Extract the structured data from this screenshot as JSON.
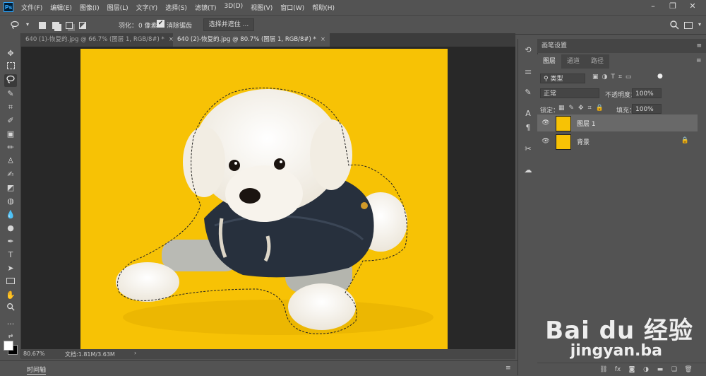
{
  "menubar": {
    "logo": "Ps",
    "items": [
      "文件(F)",
      "编辑(E)",
      "图像(I)",
      "图层(L)",
      "文字(Y)",
      "选择(S)",
      "滤镜(T)",
      "3D(D)",
      "视图(V)",
      "窗口(W)",
      "帮助(H)"
    ]
  },
  "options": {
    "feather_label": "羽化：",
    "feather_value": "0 像素",
    "antialias_label": "消除锯齿",
    "select_mask_label": "选择并遮住 ..."
  },
  "tabs": [
    {
      "label": "640 (1)-恢复的.jpg @ 66.7% (图层 1, RGB/8#) *",
      "close": "×"
    },
    {
      "label": "640 (2)-恢复的.jpg @ 80.7% (图层 1, RGB/8#) *",
      "close": "×"
    }
  ],
  "status": {
    "zoom": "80.67%",
    "doc": "文档:1.81M/3.63M",
    "arrow": "›"
  },
  "timeline_label": "时间轴",
  "panels": {
    "brush_settings": "画笔设置",
    "tabs": [
      "图层",
      "通道",
      "路径"
    ],
    "kind_filter": "类型",
    "blend_mode": "正常",
    "opacity_label": "不透明度：",
    "opacity_value": "100%",
    "lock_label": "锁定：",
    "fill_label": "填充：",
    "fill_value": "100%",
    "layers": [
      {
        "name": "图层 1",
        "selected": true,
        "locked": false
      },
      {
        "name": "背景",
        "selected": false,
        "locked": true
      }
    ]
  },
  "watermark": {
    "brand": "Bai du 经验",
    "url": "jingyan.ba"
  },
  "colors": {
    "photo_background": "#f7c205",
    "panel": "#535353",
    "canvas": "#282828"
  }
}
